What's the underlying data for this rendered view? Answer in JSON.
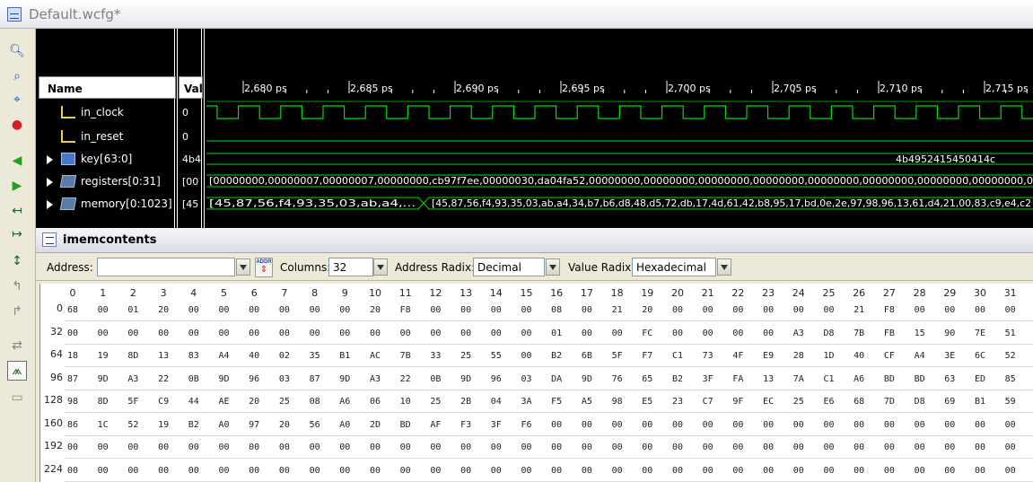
{
  "window": {
    "title": "Default.wcfg*"
  },
  "toolbar": {
    "buttons": [
      {
        "icon": "zoom-in-icon"
      },
      {
        "icon": "zoom-out-icon"
      },
      {
        "icon": "zoom-fit-icon"
      },
      {
        "icon": "zoom-cursor-icon"
      },
      {
        "icon": "go-to-start-icon"
      },
      {
        "icon": "go-to-end-icon"
      },
      {
        "icon": "previous-transition-icon"
      },
      {
        "icon": "next-transition-icon"
      },
      {
        "icon": "add-marker-icon"
      },
      {
        "icon": "previous-marker-icon"
      },
      {
        "icon": "next-marker-icon"
      },
      {
        "icon": "swap-cursors-icon"
      },
      {
        "icon": "snap-to-transition-icon"
      },
      {
        "icon": "floating-ruler-icon"
      }
    ]
  },
  "wave": {
    "name_header": "Name",
    "value_header": "Value",
    "time_labels": [
      "2,680 ps",
      "2,685 ps",
      "2,690 ps",
      "2,695 ps",
      "2,700 ps",
      "2,705 ps",
      "2,710 ps",
      "2,715 ps"
    ],
    "signals": [
      {
        "name": "in_clock",
        "value": "0",
        "kind": "wire"
      },
      {
        "name": "in_reset",
        "value": "0",
        "kind": "wire"
      },
      {
        "name": "key[63:0]",
        "value": "4b4",
        "kind": "bus"
      },
      {
        "name": "registers[0:31]",
        "value": "[00",
        "kind": "array"
      },
      {
        "name": "memory[0:1023]",
        "value": "[45",
        "kind": "array"
      }
    ],
    "key_value_text": "4b4952415450414c",
    "registers_value_text": "[00000000,00000007,00000007,00000000,cb97f7ee,00000030,da04fa52,00000000,00000000,00000000,00000000,00000000,00000000,00000000,00000000,0",
    "memory_value_text_1": "[45,87,56,f4,93,35,03,ab,a4,...",
    "memory_value_text_2": "[45,87,56,f4,93,35,03,ab,a4,34,b7,b6,d8,48,d5,72,db,17,4d,61,42,b8,95,17,bd,0e,2e,97,98,96,13,61,d4,21,00,83,c9,e4,c2"
  },
  "memory_panel": {
    "title": "imemcontents",
    "address_label": "Address:",
    "address_value": "",
    "columns_label": "Columns:",
    "columns_value": "32",
    "address_radix_label": "Address Radix:",
    "address_radix_value": "Decimal",
    "value_radix_label": "Value Radix:",
    "value_radix_value": "Hexadecimal",
    "addr_jump_label": "ADDR",
    "column_headers": [
      "0",
      "1",
      "2",
      "3",
      "4",
      "5",
      "6",
      "7",
      "8",
      "9",
      "10",
      "11",
      "12",
      "13",
      "14",
      "15",
      "16",
      "17",
      "18",
      "19",
      "20",
      "21",
      "22",
      "23",
      "24",
      "25",
      "26",
      "27",
      "28",
      "29",
      "30",
      "31"
    ],
    "rows": [
      {
        "addr": "0",
        "cells": [
          "68",
          "00",
          "01",
          "20",
          "00",
          "00",
          "00",
          "00",
          "00",
          "00",
          "20",
          "F8",
          "00",
          "00",
          "00",
          "00",
          "08",
          "00",
          "21",
          "20",
          "00",
          "00",
          "00",
          "00",
          "00",
          "00",
          "21",
          "F8",
          "00",
          "00",
          "00",
          "00"
        ]
      },
      {
        "addr": "32",
        "cells": [
          "00",
          "00",
          "00",
          "00",
          "00",
          "00",
          "00",
          "00",
          "00",
          "00",
          "00",
          "00",
          "00",
          "00",
          "00",
          "00",
          "01",
          "00",
          "00",
          "FC",
          "00",
          "00",
          "00",
          "00",
          "A3",
          "D8",
          "7B",
          "FB",
          "15",
          "90",
          "7E",
          "51"
        ]
      },
      {
        "addr": "64",
        "cells": [
          "18",
          "19",
          "8D",
          "13",
          "83",
          "A4",
          "40",
          "02",
          "35",
          "B1",
          "AC",
          "7B",
          "33",
          "25",
          "55",
          "00",
          "B2",
          "6B",
          "5F",
          "F7",
          "C1",
          "73",
          "4F",
          "E9",
          "28",
          "1D",
          "40",
          "CF",
          "A4",
          "3E",
          "6C",
          "52"
        ]
      },
      {
        "addr": "96",
        "cells": [
          "87",
          "9D",
          "A3",
          "22",
          "0B",
          "9D",
          "96",
          "03",
          "87",
          "9D",
          "A3",
          "22",
          "0B",
          "9D",
          "96",
          "03",
          "DA",
          "9D",
          "76",
          "65",
          "B2",
          "3F",
          "FA",
          "13",
          "7A",
          "C1",
          "A6",
          "BD",
          "BD",
          "63",
          "ED",
          "85"
        ]
      },
      {
        "addr": "128",
        "cells": [
          "98",
          "8D",
          "5F",
          "C9",
          "44",
          "AE",
          "20",
          "25",
          "08",
          "A6",
          "06",
          "10",
          "25",
          "2B",
          "04",
          "3A",
          "F5",
          "A5",
          "98",
          "E5",
          "23",
          "C7",
          "9F",
          "EC",
          "25",
          "E6",
          "68",
          "7D",
          "D8",
          "69",
          "B1",
          "59"
        ]
      },
      {
        "addr": "160",
        "cells": [
          "86",
          "1C",
          "52",
          "19",
          "B2",
          "A0",
          "97",
          "20",
          "56",
          "A0",
          "2D",
          "BD",
          "AF",
          "F3",
          "3F",
          "F6",
          "00",
          "00",
          "00",
          "00",
          "00",
          "00",
          "00",
          "00",
          "00",
          "00",
          "00",
          "00",
          "00",
          "00",
          "00",
          "00"
        ]
      },
      {
        "addr": "192",
        "cells": [
          "00",
          "00",
          "00",
          "00",
          "00",
          "00",
          "00",
          "00",
          "00",
          "00",
          "00",
          "00",
          "00",
          "00",
          "00",
          "00",
          "00",
          "00",
          "00",
          "00",
          "00",
          "00",
          "00",
          "00",
          "00",
          "00",
          "00",
          "00",
          "00",
          "00",
          "00",
          "00"
        ]
      },
      {
        "addr": "224",
        "cells": [
          "00",
          "00",
          "00",
          "00",
          "00",
          "00",
          "00",
          "00",
          "00",
          "00",
          "00",
          "00",
          "00",
          "00",
          "00",
          "00",
          "00",
          "00",
          "00",
          "00",
          "00",
          "00",
          "00",
          "00",
          "00",
          "00",
          "00",
          "00",
          "00",
          "00",
          "00",
          "00"
        ]
      }
    ]
  },
  "colors": {
    "wave_background": "#000000",
    "signal_green": "#00e000",
    "text_white": "#ffffff"
  }
}
